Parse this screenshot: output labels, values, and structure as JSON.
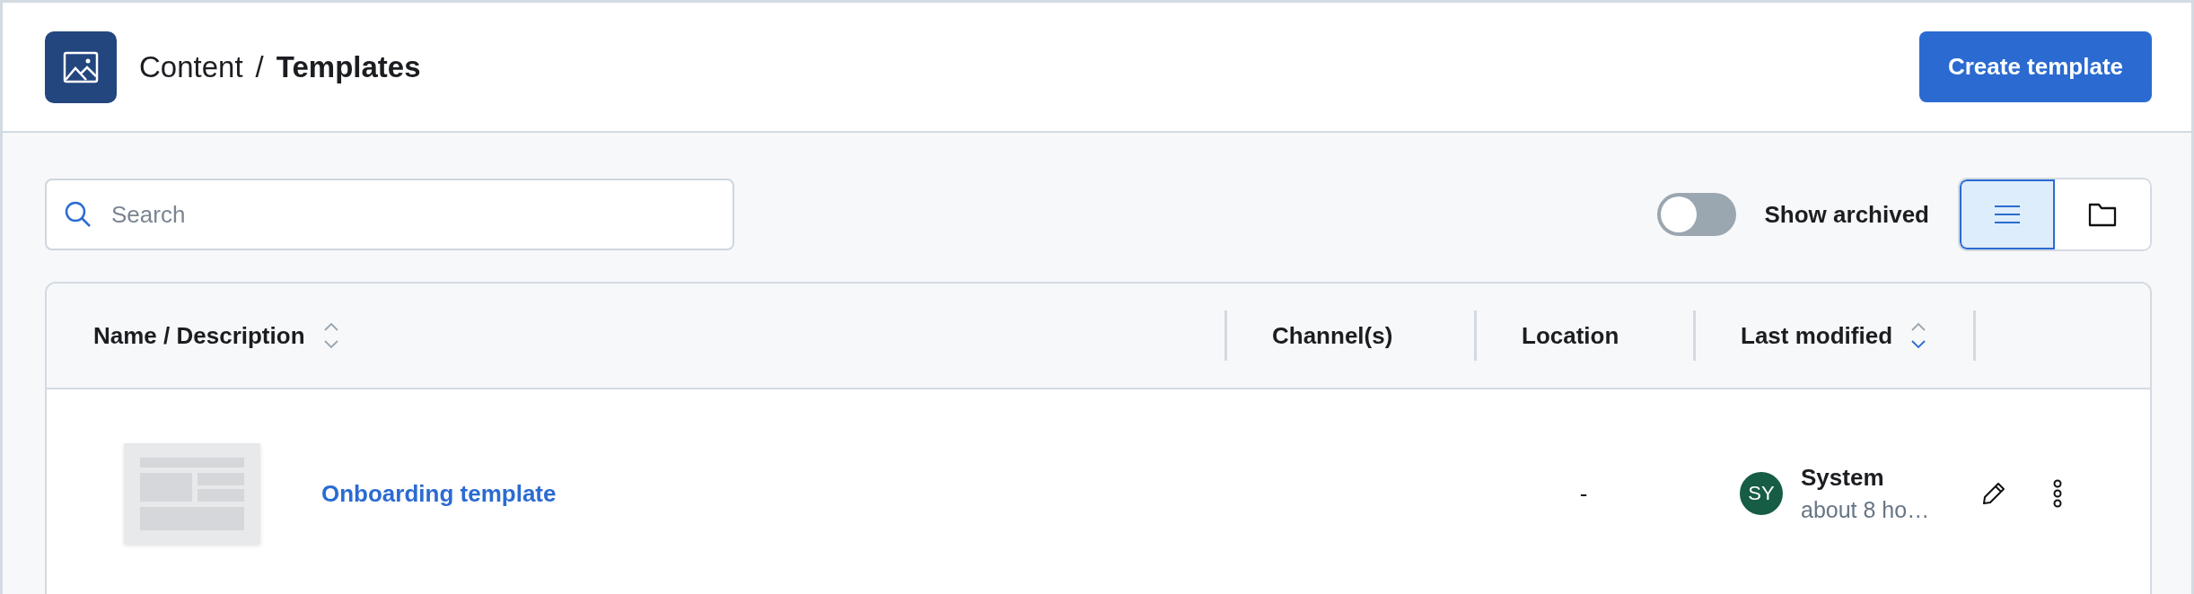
{
  "header": {
    "breadcrumb": [
      {
        "label": "Content",
        "current": false
      },
      {
        "label": "Templates",
        "current": true
      }
    ],
    "separator": "/",
    "create_button": "Create template"
  },
  "toolbar": {
    "search": {
      "placeholder": "Search"
    },
    "show_archived": {
      "label": "Show archived",
      "on": false
    },
    "views": [
      {
        "kind": "list",
        "selected": true
      },
      {
        "kind": "folder",
        "selected": false
      }
    ]
  },
  "table": {
    "columns": [
      {
        "label": "Name / Description",
        "sortable": true,
        "sorted_descending": false
      },
      {
        "label": "Channel(s)"
      },
      {
        "label": "Location"
      },
      {
        "label": "Last modified",
        "sortable": true,
        "sorted_descending": true
      }
    ],
    "rows": [
      {
        "name": "Onboarding template",
        "location": "-",
        "modified_by": {
          "initials": "SY",
          "name": "System",
          "time": "about 8 ho…",
          "color": "#175c45"
        }
      }
    ]
  }
}
